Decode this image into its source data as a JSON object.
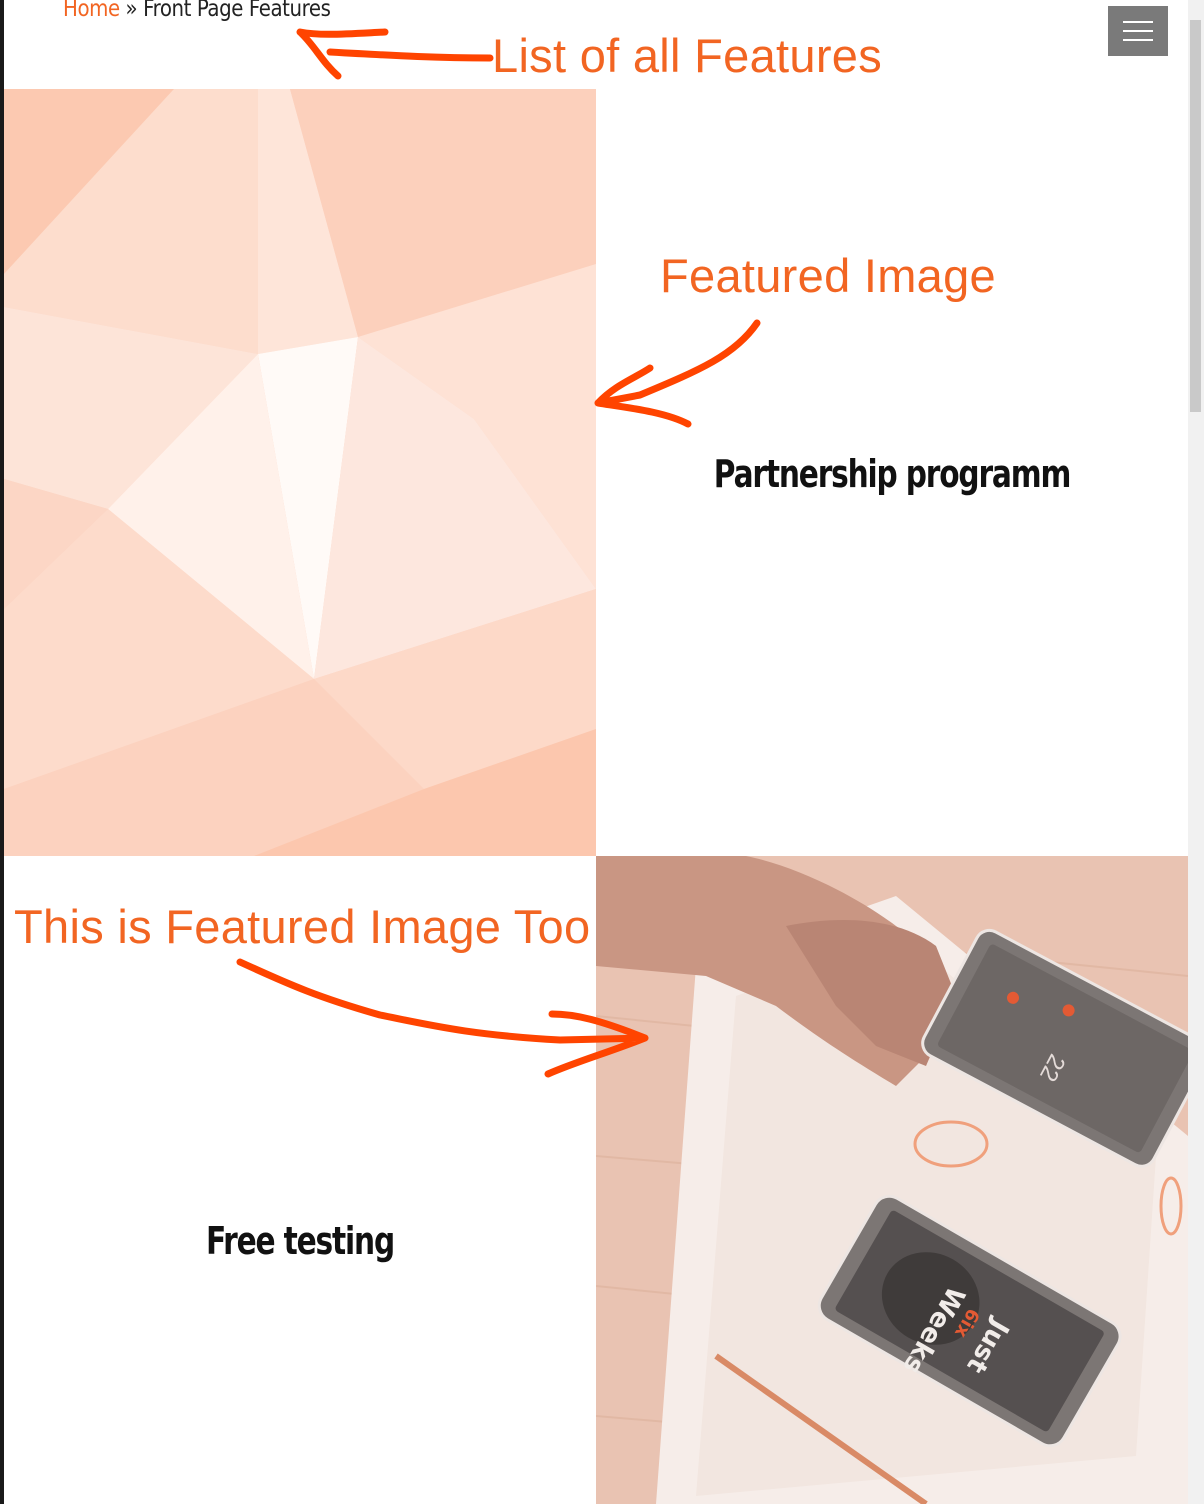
{
  "breadcrumb": {
    "home_label": "Home",
    "separator": "»",
    "current_label": "Front Page Features"
  },
  "menu": {
    "icon": "hamburger-icon"
  },
  "features": [
    {
      "title": "Partnership programm",
      "image": "abstract-polygon-image"
    },
    {
      "title": "Free testing",
      "image": "phones-on-desk-image"
    }
  ],
  "phone_screens": {
    "top_phone_number": "22",
    "bottom_phone_lines": [
      "Just",
      "Weeks"
    ],
    "bottom_phone_logo": "6ix"
  },
  "annotations": {
    "list_label": "List of all Features",
    "featured_label": "Featured Image",
    "featured_too_label": "This is Featured Image Too"
  },
  "colors": {
    "accent": "#f26522",
    "annotation": "#ff4400",
    "menu_button": "#7a7a7a",
    "polygon_base": "#fcd3c0"
  }
}
